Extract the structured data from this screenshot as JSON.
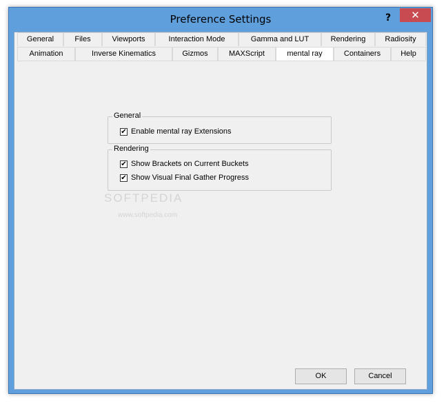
{
  "window": {
    "title": "Preference Settings",
    "help_label": "?",
    "close_label": "✕"
  },
  "tabs": {
    "row1": [
      "General",
      "Files",
      "Viewports",
      "Interaction Mode",
      "Gamma and LUT",
      "Rendering",
      "Radiosity"
    ],
    "row2": [
      "Animation",
      "Inverse Kinematics",
      "Gizmos",
      "MAXScript",
      "mental ray",
      "Containers",
      "Help"
    ],
    "active": "mental ray"
  },
  "groups": {
    "general": {
      "title": "General",
      "items": [
        {
          "label": "Enable mental ray Extensions",
          "checked": true
        }
      ]
    },
    "rendering": {
      "title": "Rendering",
      "items": [
        {
          "label": "Show Brackets on Current Buckets",
          "checked": true
        },
        {
          "label": "Show Visual Final Gather Progress",
          "checked": true
        }
      ]
    }
  },
  "buttons": {
    "ok": "OK",
    "cancel": "Cancel"
  },
  "watermark": {
    "text": "SOFTPEDIA",
    "url": "www.softpedia.com"
  },
  "colors": {
    "frame": "#5e9fdc",
    "close": "#c74b50",
    "client": "#f0f0f0"
  }
}
